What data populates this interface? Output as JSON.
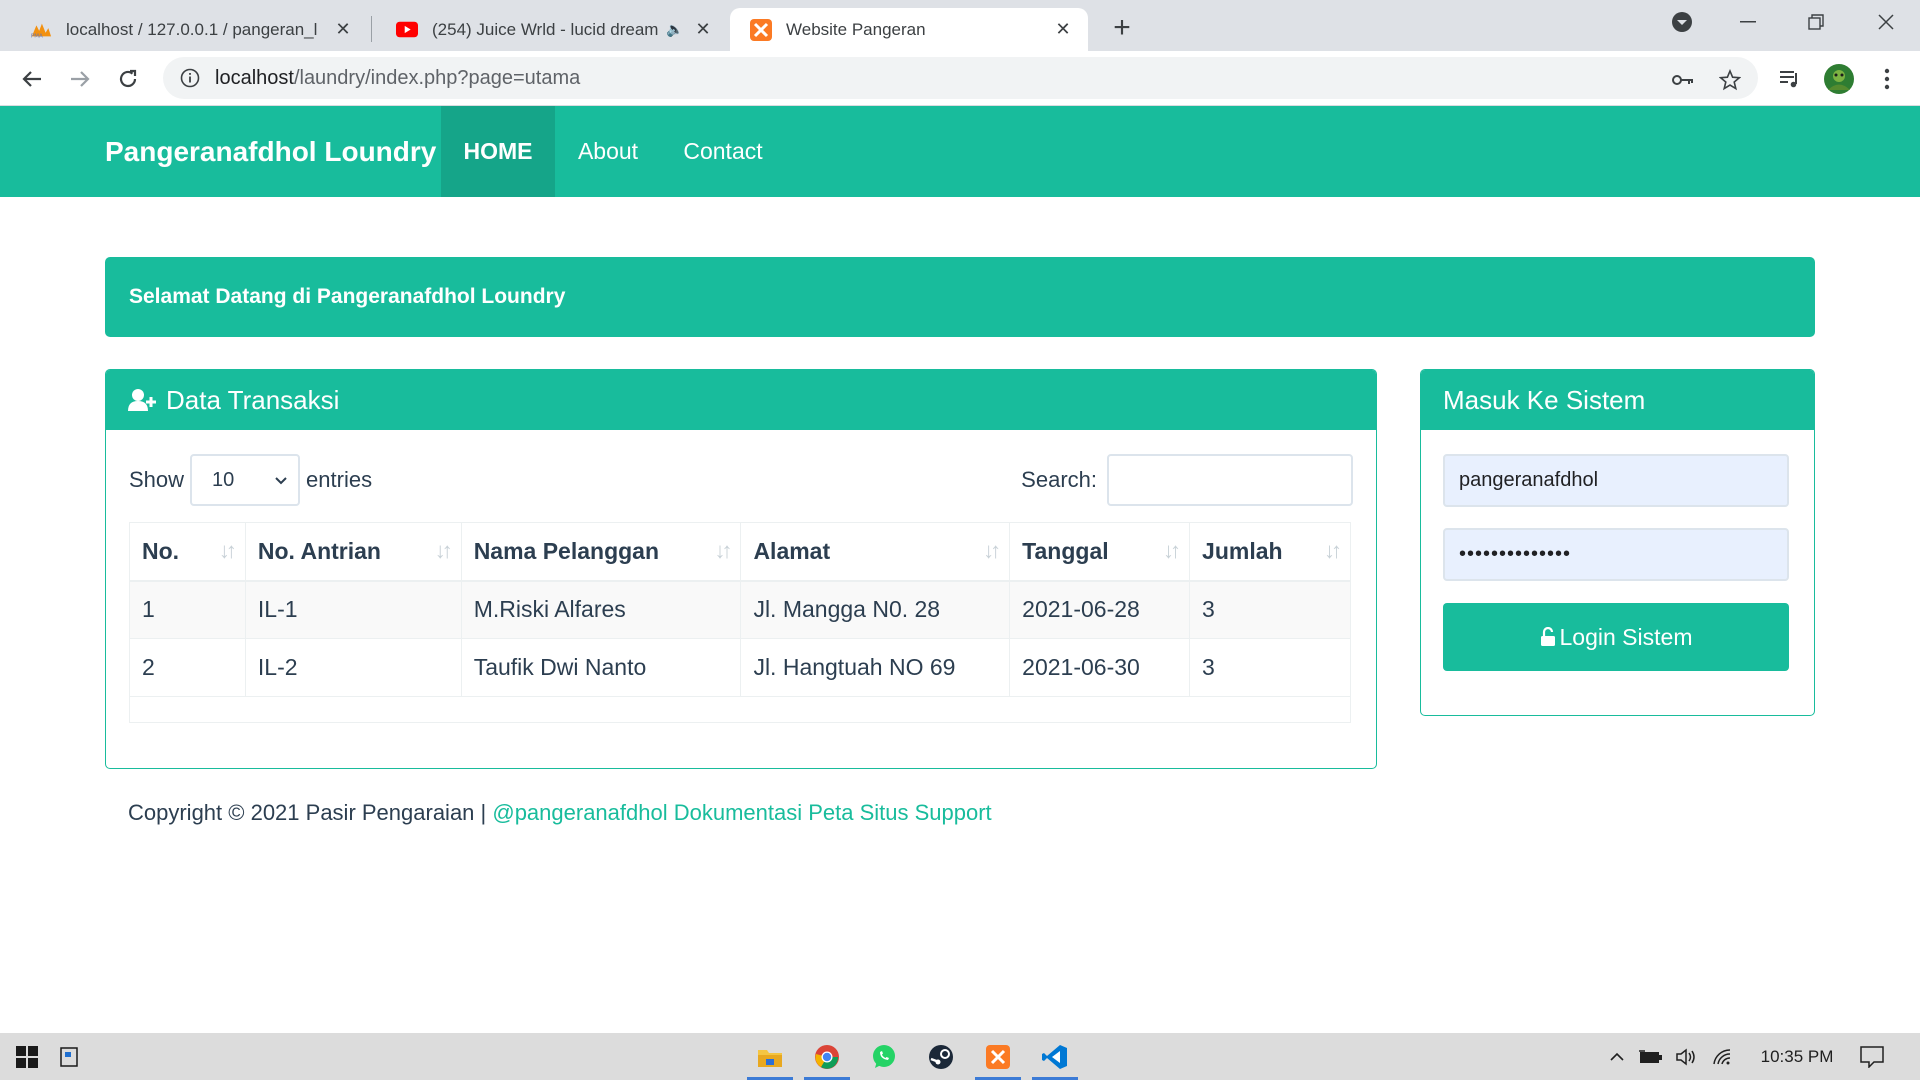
{
  "browser": {
    "tabs": [
      {
        "title": "localhost / 127.0.0.1 / pangeran_l",
        "icon": "phpmyadmin-icon",
        "active": false
      },
      {
        "title": "(254) Juice Wrld - lucid dream",
        "icon": "youtube-icon",
        "active": false,
        "audio_icon": "speaker-icon"
      },
      {
        "title": "Website Pangeran",
        "icon": "xampp-icon",
        "active": true
      }
    ],
    "new_tab_label": "+",
    "url_host": "localhost",
    "url_path": "/laundry/index.php?page=utama"
  },
  "navbar": {
    "brand": "Pangeranafdhol Loundry",
    "items": [
      {
        "label": "HOME",
        "active": true
      },
      {
        "label": "About",
        "active": false
      },
      {
        "label": "Contact",
        "active": false
      }
    ]
  },
  "banner": {
    "text": "Selamat Datang di Pangeranafdhol Loundry"
  },
  "transactions": {
    "title": "Data Transaksi",
    "show_label": "Show",
    "entries_value": "10",
    "entries_label": "entries",
    "search_label": "Search:",
    "search_value": "",
    "columns": [
      "No.",
      "No. Antrian",
      "Nama Pelanggan",
      "Alamat",
      "Tanggal",
      "Jumlah"
    ],
    "rows": [
      [
        "1",
        "IL-1",
        "M.Riski Alfares",
        "Jl. Mangga N0. 28",
        "2021-06-28",
        "3"
      ],
      [
        "2",
        "IL-2",
        "Taufik Dwi Nanto",
        "Jl. Hangtuah NO 69",
        "2021-06-30",
        "3"
      ]
    ]
  },
  "login": {
    "title": "Masuk Ke Sistem",
    "username": "pangeranafdhol",
    "password_mask": "••••••••••••••",
    "button_label": "Login Sistem"
  },
  "footer": {
    "copyright": "Copyright © 2021 Pasir Pengaraian | ",
    "links": "@pangeranafdhol Dokumentasi Peta Situs Support"
  },
  "taskbar": {
    "clock": "10:35 PM",
    "pinned": [
      "file-explorer-icon",
      "chrome-icon",
      "whatsapp-icon",
      "steam-icon",
      "xampp-icon",
      "vscode-icon"
    ]
  },
  "colors": {
    "brand": "#18bc9c",
    "brand_dark": "#15a589",
    "text": "#2c3e50"
  }
}
